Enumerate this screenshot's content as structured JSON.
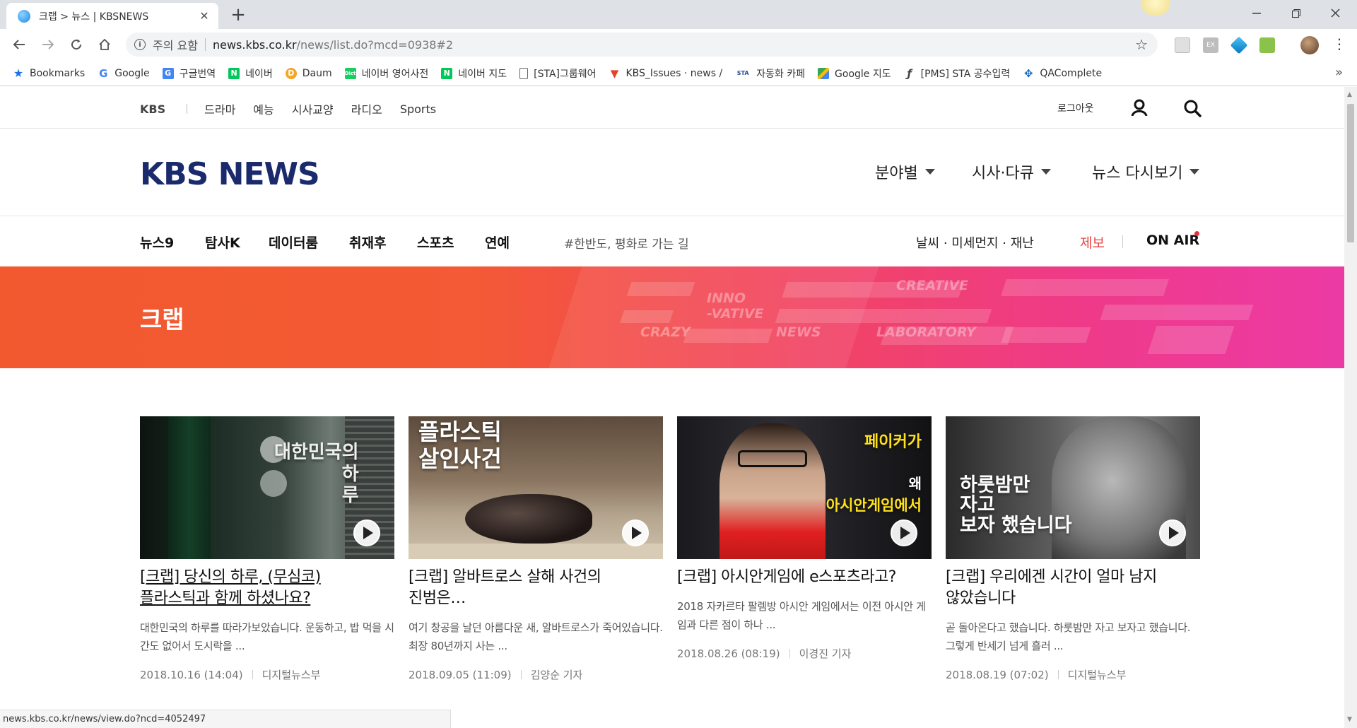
{
  "browser": {
    "tab_title": "크랩 > 뉴스 | KBSNEWS",
    "new_tab": "+",
    "security_label": "주의 요함",
    "url_host": "news.kbs.co.kr",
    "url_path": "/news/list.do?mcd=0938#2",
    "bookmarks": [
      {
        "label": "Bookmarks",
        "icon": "star-icon",
        "color": "#1a73e8"
      },
      {
        "label": "Google",
        "icon": "google-icon",
        "color": "#4285f4"
      },
      {
        "label": "구글번역",
        "icon": "translate-icon",
        "color": "#4285f4"
      },
      {
        "label": "네이버",
        "icon": "naver-icon",
        "color": "#03c75a"
      },
      {
        "label": "Daum",
        "icon": "daum-icon",
        "color": "#f5a623"
      },
      {
        "label": "네이버 영어사전",
        "icon": "dict-icon",
        "color": "#19ce60"
      },
      {
        "label": "네이버 지도",
        "icon": "naver-icon",
        "color": "#03c75a"
      },
      {
        "label": "[STA]그룹웨어",
        "icon": "page-icon",
        "color": "#888888"
      },
      {
        "label": "KBS_Issues · news / ",
        "icon": "gitlab-icon",
        "color": "#e24329"
      },
      {
        "label": "자동화 카페",
        "icon": "sta-icon",
        "color": "#2c4a9a"
      },
      {
        "label": "Google 지도",
        "icon": "maps-icon",
        "color": "#34a853"
      },
      {
        "label": "[PMS] STA 공수입력",
        "icon": "redmine-icon",
        "color": "#444444"
      },
      {
        "label": "QAComplete",
        "icon": "qa-icon",
        "color": "#1565c0"
      }
    ],
    "more": "»",
    "status_url": "news.kbs.co.kr/news/view.do?ncd=4052497"
  },
  "gnb": {
    "brand": "KBS",
    "items": [
      "드라마",
      "예능",
      "시사교양",
      "라디오",
      "Sports"
    ],
    "logout": "로그아웃"
  },
  "header": {
    "logo": "KBS NEWS",
    "menus": [
      "분야별",
      "시사·다큐",
      "뉴스 다시보기"
    ]
  },
  "subnav": {
    "items": [
      "뉴스9",
      "탐사K",
      "데이터룸",
      "취재후",
      "스포츠",
      "연예"
    ],
    "tag": "#한반도, 평화로 가는 길",
    "weather": "날씨 · 미세먼지 · 재난",
    "report": "제보",
    "onair": "ON AIR"
  },
  "banner": {
    "title": "크랩",
    "deco": [
      "INNO\n-VATIVE",
      "CREATIVE",
      "CRAZY",
      "NEWS",
      "LABORATORY"
    ]
  },
  "colors": {
    "brand_navy": "#1a2a6c",
    "report_red": "#e84545",
    "banner_orange": "#f2592f",
    "banner_pink": "#ec3aa5"
  },
  "cards": [
    {
      "thumb_text": "대한민국의\n하\n루",
      "title": "[크랩] 당신의 하루, (무심코)\n플라스틱과 함께 하셨나요?",
      "desc": "대한민국의 하루를 따라가보았습니다. 운동하고, 밥 먹을 시간도 없어서 도시락을 ...",
      "date": "2018.10.16 (14:04)",
      "author": "디지털뉴스부"
    },
    {
      "thumb_text": "플라스틱\n살인사건",
      "title": "[크랩] 알바트로스 살해 사건의\n진범은…",
      "desc": "여기 창공을 날던 아름다운 새, 알바트로스가 죽어있습니다. 최장 80년까지 사는 ...",
      "date": "2018.09.05 (11:09)",
      "author": "김양순 기자"
    },
    {
      "thumb_text_1": "페이커가",
      "thumb_text_2": "왜",
      "thumb_text_3": "아시안게임에서",
      "title": "[크랩] 아시안게임에 e스포츠라고?",
      "desc": "2018 자카르타 팔렘방 아시안 게임에서는 이전 아시안 게임과 다른 점이 하나 ...",
      "date": "2018.08.26 (08:19)",
      "author": "이경진 기자"
    },
    {
      "thumb_text": "하룻밤만\n자고\n보자 했습니다",
      "title": "[크랩] 우리에겐 시간이 얼마 남지\n않았습니다",
      "desc": "곧 돌아온다고 했습니다. 하룻밤만 자고 보자고 했습니다. 그렇게 반세기 넘게 흘러 ...",
      "date": "2018.08.19 (07:02)",
      "author": "디지털뉴스부"
    }
  ]
}
